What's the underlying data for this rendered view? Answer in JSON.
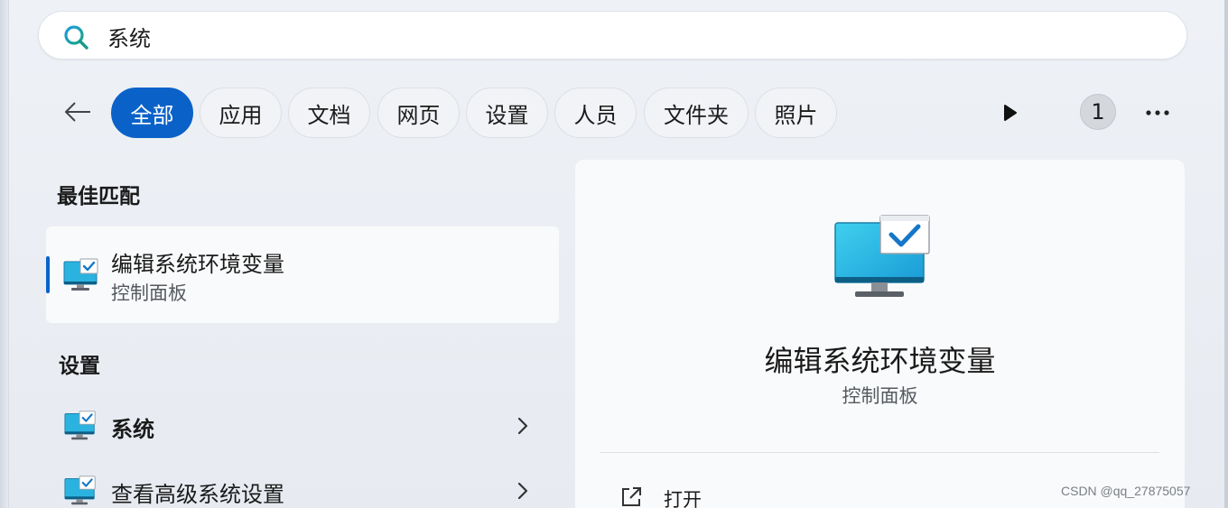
{
  "search": {
    "value": "系统"
  },
  "filters": {
    "chips": [
      {
        "label": "全部",
        "active": true
      },
      {
        "label": "应用",
        "active": false
      },
      {
        "label": "文档",
        "active": false
      },
      {
        "label": "网页",
        "active": false
      },
      {
        "label": "设置",
        "active": false
      },
      {
        "label": "人员",
        "active": false
      },
      {
        "label": "文件夹",
        "active": false
      },
      {
        "label": "照片",
        "active": false
      }
    ],
    "count_badge": "1"
  },
  "best_match": {
    "heading": "最佳匹配",
    "title": "编辑系统环境变量",
    "subtitle": "控制面板"
  },
  "settings": {
    "heading": "设置",
    "items": [
      {
        "label": "系统"
      },
      {
        "label": "查看高级系统设置"
      }
    ]
  },
  "preview": {
    "title": "编辑系统环境变量",
    "subtitle": "控制面板",
    "actions": [
      {
        "label": "打开",
        "icon": "open-external-icon"
      }
    ]
  },
  "watermark": "CSDN @qq_27875057",
  "colors": {
    "accent": "#0a62c9",
    "search_icon": "#0a7fc0",
    "monitor_screen": "#2bb3e0"
  }
}
